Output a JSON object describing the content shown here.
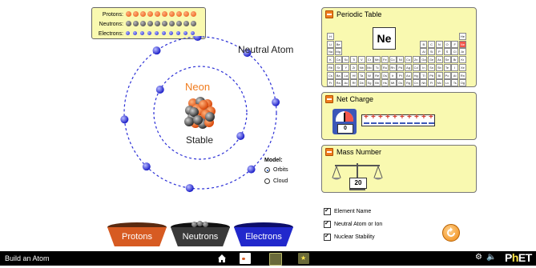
{
  "counter": {
    "protons_label": "Protons:",
    "neutrons_label": "Neutrons:",
    "electrons_label": "Electrons:",
    "protons": 10,
    "neutrons": 10,
    "electrons": 10
  },
  "atom": {
    "element_name": "Neon",
    "status": "Neutral Atom",
    "stability": "Stable"
  },
  "model": {
    "label": "Model:",
    "options": [
      "Orbits",
      "Cloud"
    ],
    "selected": "Orbits"
  },
  "periodic_table": {
    "title": "Periodic Table",
    "selected_symbol": "Ne"
  },
  "net_charge": {
    "title": "Net Charge",
    "value": "0"
  },
  "mass_number": {
    "title": "Mass Number",
    "value": "20"
  },
  "buckets": [
    "Protons",
    "Neutrons",
    "Electrons"
  ],
  "options": [
    "Element Name",
    "Neutral Atom or Ion",
    "Nuclear Stability"
  ],
  "navbar": {
    "sim_title": "Build an Atom",
    "brand": "PhET"
  },
  "colors": {
    "panel": "#f9f9b0",
    "proton": "#e8550e",
    "neutron": "#444444",
    "electron": "#1e22cc",
    "accent": "#f07c1e"
  }
}
